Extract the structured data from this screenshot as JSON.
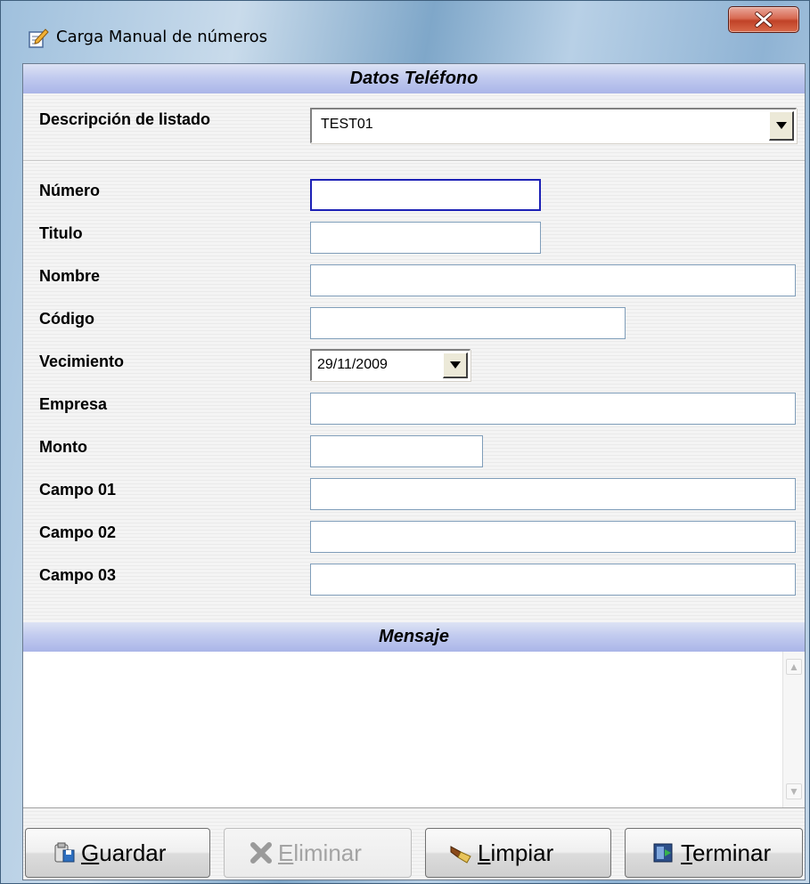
{
  "window": {
    "title": "Carga Manual de números"
  },
  "sections": {
    "datos": "Datos Teléfono",
    "mensaje": "Mensaje"
  },
  "listado": {
    "label": "Descripción de listado",
    "value": "TEST01"
  },
  "fields": {
    "numero": {
      "label": "Número",
      "value": ""
    },
    "titulo": {
      "label": "Titulo",
      "value": ""
    },
    "nombre": {
      "label": "Nombre",
      "value": ""
    },
    "codigo": {
      "label": "Código",
      "value": ""
    },
    "vencimiento": {
      "label": "Vecimiento",
      "value": "29/11/2009"
    },
    "empresa": {
      "label": "Empresa",
      "value": ""
    },
    "monto": {
      "label": "Monto",
      "value": ""
    },
    "campo01": {
      "label": "Campo 01",
      "value": ""
    },
    "campo02": {
      "label": "Campo 02",
      "value": ""
    },
    "campo03": {
      "label": "Campo 03",
      "value": ""
    }
  },
  "mensaje": {
    "text": ""
  },
  "buttons": {
    "guardar": {
      "accel": "G",
      "rest": "uardar"
    },
    "eliminar": {
      "accel": "E",
      "rest": "liminar"
    },
    "limpiar": {
      "accel": "L",
      "rest": "impiar"
    },
    "terminar": {
      "accel": "T",
      "rest": "erminar"
    }
  },
  "colors": {
    "section_header": "#b4bdeb",
    "focus_border": "#1d21b6",
    "close_button": "#c84a30"
  },
  "icons": [
    "form-edit-icon",
    "close-icon",
    "save-icon",
    "delete-x-icon",
    "broom-icon",
    "exit-icon",
    "scroll-up-icon",
    "scroll-down-icon",
    "dropdown-arrow-icon"
  ]
}
